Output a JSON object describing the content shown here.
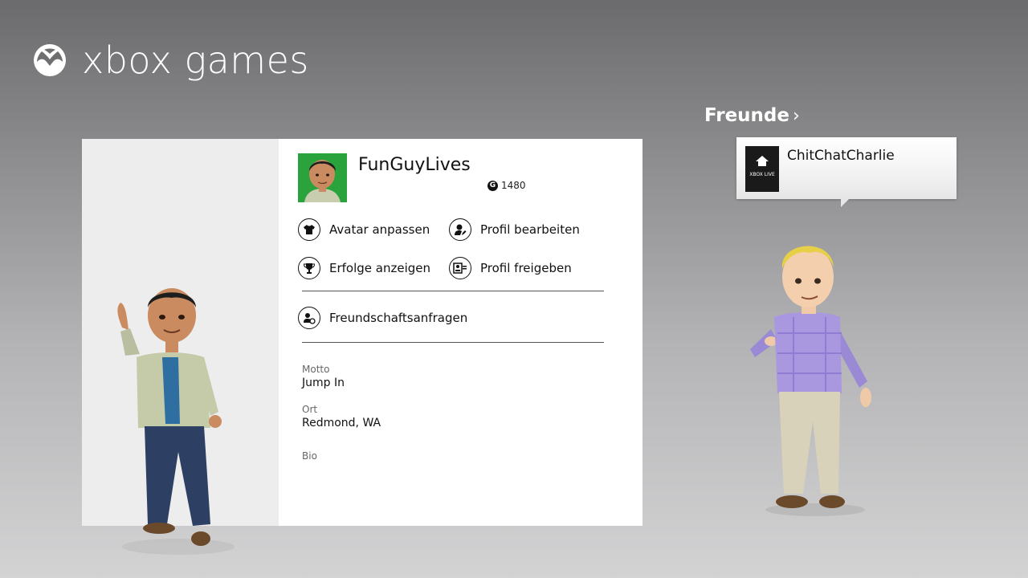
{
  "app": {
    "title": "xbox games",
    "logo_icon": "xbox-logo-icon"
  },
  "profile": {
    "gamertag": "FunGuyLives",
    "gamerscore": "1480",
    "gamerscore_icon": "G",
    "actions": [
      {
        "label": "Avatar anpassen",
        "icon": "shirt-icon"
      },
      {
        "label": "Profil bearbeiten",
        "icon": "edit-profile-icon"
      },
      {
        "label": "Erfolge anzeigen",
        "icon": "trophy-icon"
      },
      {
        "label": "Profil freigeben",
        "icon": "share-profile-icon"
      },
      {
        "label": "Freundschaftsanfragen",
        "icon": "friend-request-icon"
      }
    ],
    "info": [
      {
        "label": "Motto",
        "value": "Jump In"
      },
      {
        "label": "Ort",
        "value": "Redmond, WA"
      },
      {
        "label": "Bio",
        "value": ""
      }
    ]
  },
  "friends": {
    "heading": "Freunde",
    "chevron": "›",
    "list": [
      {
        "name": "ChitChatCharlie",
        "tile_icon": "xbox-live-icon",
        "tile_text": "XBOX LIVE"
      }
    ]
  },
  "colors": {
    "accent_green": "#2aa33c",
    "card_bg": "#ffffff",
    "avatar_pane_bg": "#ededee"
  }
}
